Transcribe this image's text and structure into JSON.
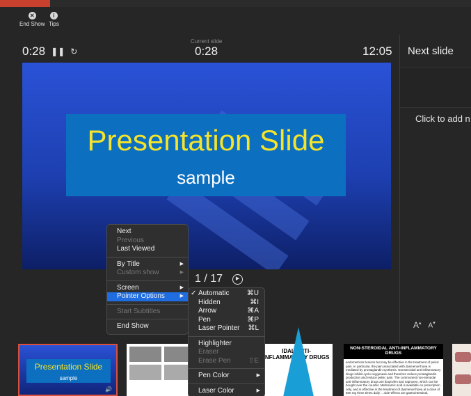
{
  "toolbar": {
    "end_show": {
      "label": "End Show",
      "icon": "close-circle-icon"
    },
    "tips": {
      "label": "Tips",
      "icon": "info-icon"
    }
  },
  "timer": {
    "elapsed": "0:28",
    "pause_icon": "❚❚",
    "reset_icon": "↻"
  },
  "current_slide": {
    "label": "Current slide",
    "time": "0:28"
  },
  "clock": "12:05",
  "next_slide": {
    "label": "Next slide"
  },
  "notes_placeholder": "Click to add n",
  "font_buttons": {
    "increase": "A",
    "decrease": "A"
  },
  "slide": {
    "title": "Presentation Slide",
    "subtitle": "sample"
  },
  "counter": {
    "text": "1 / 17"
  },
  "context_menu": {
    "next": "Next",
    "previous": "Previous",
    "last_viewed": "Last Viewed",
    "by_title": "By Title",
    "custom_show": "Custom show",
    "screen": "Screen",
    "pointer_options": "Pointer Options",
    "start_subtitles": "Start Subtitles",
    "end_show": "End Show"
  },
  "pointer_submenu": {
    "automatic": {
      "label": "Automatic",
      "shortcut": "⌘U"
    },
    "hidden": {
      "label": "Hidden",
      "shortcut": "⌘I"
    },
    "arrow": {
      "label": "Arrow",
      "shortcut": "⌘A"
    },
    "pen": {
      "label": "Pen",
      "shortcut": "⌘P"
    },
    "laser": {
      "label": "Laser Pointer",
      "shortcut": "⌘L"
    },
    "highlighter": "Highlighter",
    "eraser": "Eraser",
    "erase_pen": {
      "label": "Erase Pen",
      "shortcut": "⇧E"
    },
    "pen_color": "Pen Color",
    "laser_color": "Laser Color"
  },
  "thumbnails": {
    "t1": {
      "title": "Presentation Slide",
      "subtitle": "sample"
    },
    "t3": {
      "title": "IDAL ANTI-INFLAMMATORY DRUGS"
    },
    "t4": {
      "title": "NON-STEROIDAL ANTI-INFLAMMATORY DRUGS",
      "body": "endometriotic lesions but may be effective in the treatment of pelvic pain. In particular, the pain associated with dysmenorrhoea is mediated by prostaglandin synthesis. Nonsteroidal anti-inflammatory drugs inhibit cyclo-oxygenase and therefore reduce prostaglandin production and reduce pelvic pain. The commonest non-steroidal anti-inflammatory drugs are ibuprofen and naproxen, which can be bought over the counter. Mefenamic acid is available on prescription only, and is effective in the treatment of dysmenorrhoea at a dose of 500 mg three times daily. ...side-effects are gastrointestinal, particularly gastric..."
    }
  },
  "colors": {
    "accent_red": "#c9402f",
    "menu_highlight": "#1f6de0",
    "slide_title": "#f5e42a",
    "laser": "#1a9ed6"
  }
}
